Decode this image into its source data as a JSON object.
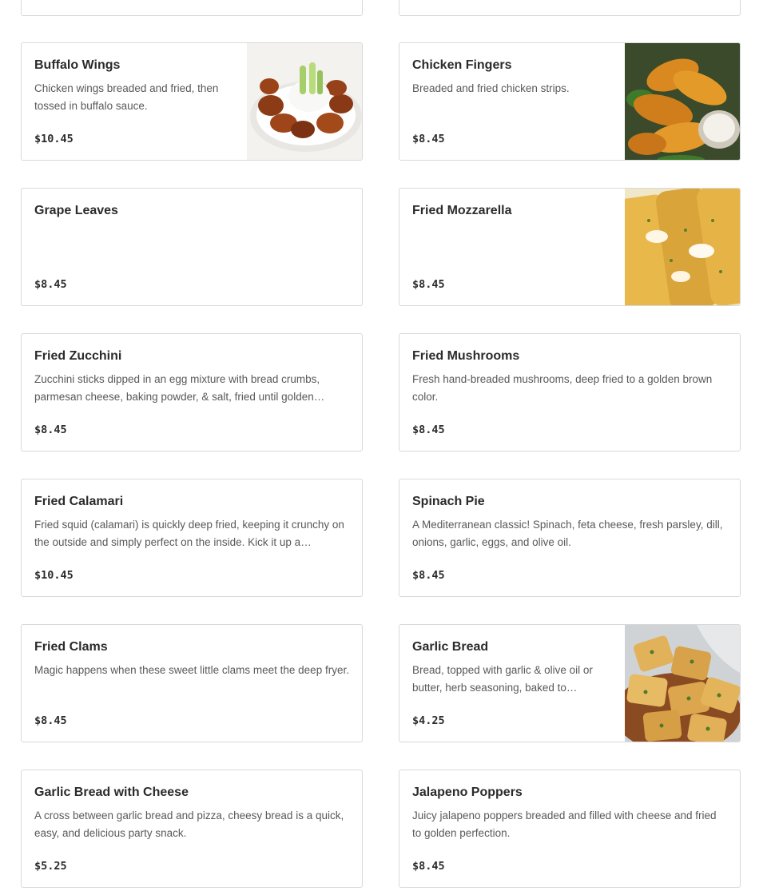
{
  "menu_items": [
    {
      "name": "Buffalo Wings",
      "description": "Chicken wings breaded and fried, then tossed in buffalo sauce.",
      "price": "$10.45",
      "image": "buffalo-wings-photo"
    },
    {
      "name": "Chicken Fingers",
      "description": "Breaded and fried chicken strips.",
      "price": "$8.45",
      "image": "chicken-fingers-photo"
    },
    {
      "name": "Grape Leaves",
      "description": "",
      "price": "$8.45",
      "image": ""
    },
    {
      "name": "Fried Mozzarella",
      "description": "",
      "price": "$8.45",
      "image": "fried-mozzarella-photo"
    },
    {
      "name": "Fried Zucchini",
      "description": "Zucchini sticks dipped in an egg mixture with bread crumbs, parmesan cheese, baking powder, & salt, fried until golden…",
      "price": "$8.45",
      "image": ""
    },
    {
      "name": "Fried Mushrooms",
      "description": "Fresh hand-breaded mushrooms, deep fried to a golden brown color.",
      "price": "$8.45",
      "image": ""
    },
    {
      "name": "Fried Calamari",
      "description": "Fried squid (calamari) is quickly deep fried, keeping it crunchy on the outside and simply perfect on the inside. Kick it up a…",
      "price": "$10.45",
      "image": ""
    },
    {
      "name": "Spinach Pie",
      "description": "A Mediterranean classic! Spinach, feta cheese, fresh parsley, dill, onions, garlic, eggs, and olive oil.",
      "price": "$8.45",
      "image": ""
    },
    {
      "name": "Fried Clams",
      "description": "Magic happens when these sweet little clams meet the deep fryer.",
      "price": "$8.45",
      "image": ""
    },
    {
      "name": "Garlic Bread",
      "description": "Bread, topped with garlic & olive oil or butter, herb seasoning, baked to…",
      "price": "$4.25",
      "image": "garlic-bread-photo"
    },
    {
      "name": "Garlic Bread with Cheese",
      "description": "A cross between garlic bread and pizza, cheesy bread is a quick, easy, and delicious party snack.",
      "price": "$5.25",
      "image": ""
    },
    {
      "name": "Jalapeno Poppers",
      "description": "Juicy jalapeno poppers breaded and filled with cheese and fried to golden perfection.",
      "price": "$8.45",
      "image": ""
    }
  ]
}
